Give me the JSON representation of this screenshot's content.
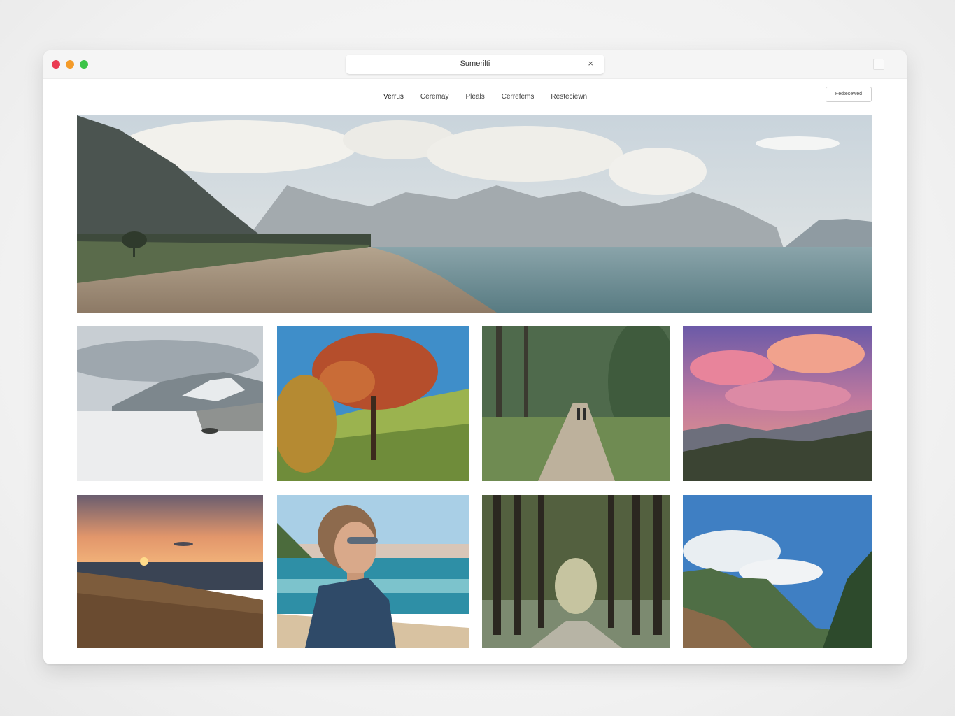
{
  "window": {
    "tab_title": "Sumerilti",
    "tab_close": "×"
  },
  "nav": {
    "items": [
      "Verrus",
      "Ceremay",
      "Pleals",
      "Cerrefems",
      "Resteciewn"
    ],
    "button_label": "Fedtesewed"
  },
  "gallery": {
    "hero": {
      "subject": "mountain-lake-road"
    },
    "grid": [
      {
        "subject": "snowy-mountain-beach"
      },
      {
        "subject": "autumn-tree-hill"
      },
      {
        "subject": "forest-path-walkers"
      },
      {
        "subject": "pink-sunset-mountains"
      },
      {
        "subject": "sunset-over-sea"
      },
      {
        "subject": "woman-sunglasses-beach"
      },
      {
        "subject": "pine-forest-road"
      },
      {
        "subject": "mountain-valley-sky"
      }
    ]
  },
  "colors": {
    "close": "#ea3b52",
    "minimize": "#f49b29",
    "maximize": "#3cc448"
  }
}
